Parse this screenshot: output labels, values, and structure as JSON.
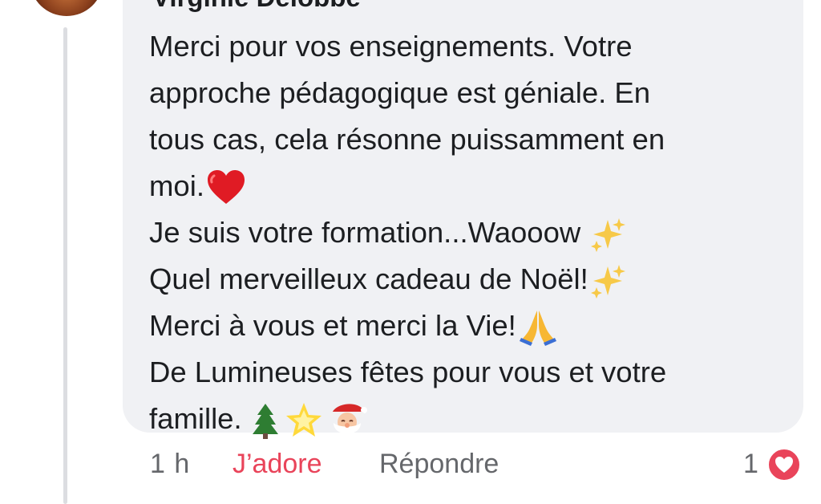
{
  "comment": {
    "author": "Virginie Delobbe",
    "lines": [
      "Merci pour vos enseignements. Votre",
      "approche pédagogique est géniale. En",
      "tous cas, cela résonne puissamment en",
      "moi.",
      "Je suis votre formation...Waooow ",
      "Quel merveilleux cadeau de Noël!",
      "Merci à vous et merci la Vie!",
      "De Lumineuses fêtes pour vous et votre",
      "famille. "
    ],
    "emojis": {
      "line4": [
        "red-heart"
      ],
      "line5": [
        "sparkles"
      ],
      "line6": [
        "sparkles"
      ],
      "line7": [
        "folded-hands"
      ],
      "line9": [
        "christmas-tree",
        "glowing-star",
        "santa-claus"
      ]
    }
  },
  "actions": {
    "timestamp": "1 h",
    "love_label": "J’adore",
    "reply_label": "Répondre"
  },
  "reactions": {
    "count": "1",
    "icon": "heart-reaction-icon",
    "color": "#e9445a"
  }
}
